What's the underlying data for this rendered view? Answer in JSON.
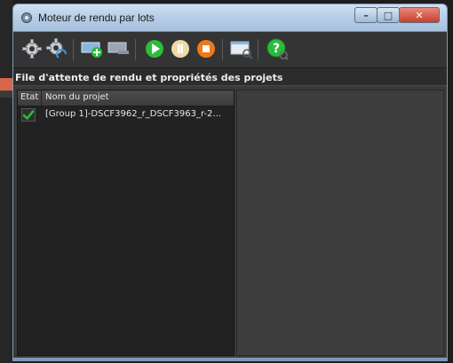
{
  "window": {
    "title": "Moteur de rendu par lots",
    "caption_buttons": {
      "minimize": "–",
      "maximize": "□",
      "close": "✕"
    }
  },
  "toolbar": {
    "buttons": [
      {
        "icon": "gear-icon"
      },
      {
        "icon": "gear-refresh-icon"
      },
      {
        "icon": "add-item-icon"
      },
      {
        "icon": "remove-item-icon"
      },
      {
        "icon": "play-icon"
      },
      {
        "icon": "pause-icon"
      },
      {
        "icon": "stop-icon"
      },
      {
        "icon": "preview-icon"
      },
      {
        "icon": "help-icon"
      }
    ]
  },
  "queue": {
    "section_title": "File d'attente de rendu et propriétés des projets",
    "columns": {
      "status": "Etat",
      "name": "Nom du projet"
    },
    "rows": [
      {
        "checked": true,
        "name": "[Group 1]-DSCF3962_r_DSCF3963_r-2..."
      }
    ]
  },
  "colors": {
    "accent_green": "#2bbd3a",
    "accent_orange": "#f07a1a",
    "titlebar": "#b6cde6"
  }
}
